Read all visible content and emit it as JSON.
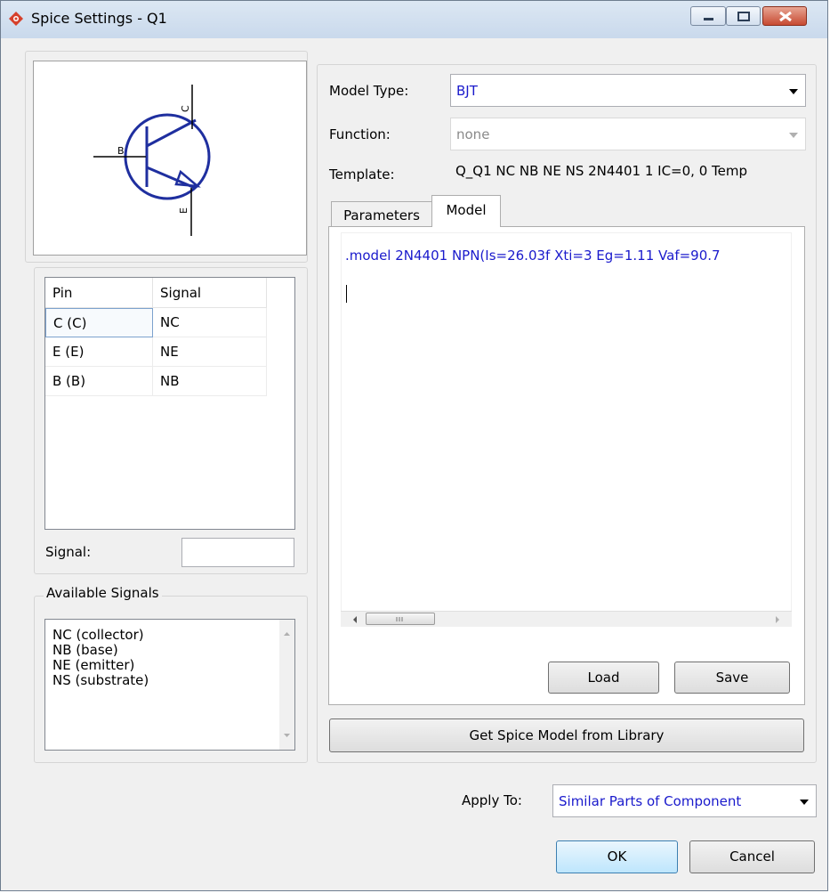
{
  "window": {
    "title": "Spice Settings - Q1"
  },
  "symbol": {
    "pin_labels": [
      "C",
      "B",
      "E"
    ]
  },
  "pin_table": {
    "headers": [
      "Pin",
      "Signal"
    ],
    "rows": [
      {
        "pin": "C (C)",
        "signal": "NC"
      },
      {
        "pin": "E (E)",
        "signal": "NE"
      },
      {
        "pin": "B (B)",
        "signal": "NB"
      }
    ]
  },
  "signal_field": {
    "label": "Signal:",
    "value": ""
  },
  "available_signals": {
    "title": "Available Signals",
    "items": [
      "NC (collector)",
      "NB (base)",
      "NE (emitter)",
      "NS (substrate)"
    ]
  },
  "model": {
    "type_label": "Model Type:",
    "type_value": "BJT",
    "function_label": "Function:",
    "function_value": "none",
    "template_label": "Template:",
    "template_value": "Q_Q1 NC NB NE NS 2N4401 1 IC=0, 0 Temp"
  },
  "tabs": [
    "Parameters",
    "Model"
  ],
  "editor": {
    "text": ".model 2N4401 NPN(Is=26.03f Xti=3 Eg=1.11 Vaf=90.7"
  },
  "buttons": {
    "load": "Load",
    "save": "Save",
    "get_model": "Get Spice Model from Library",
    "ok": "OK",
    "cancel": "Cancel"
  },
  "apply_to": {
    "label": "Apply To:",
    "value": "Similar Parts of Component"
  },
  "colors": {
    "value_text": "#1a1acc",
    "symbol_blue": "#1f2f9f"
  }
}
